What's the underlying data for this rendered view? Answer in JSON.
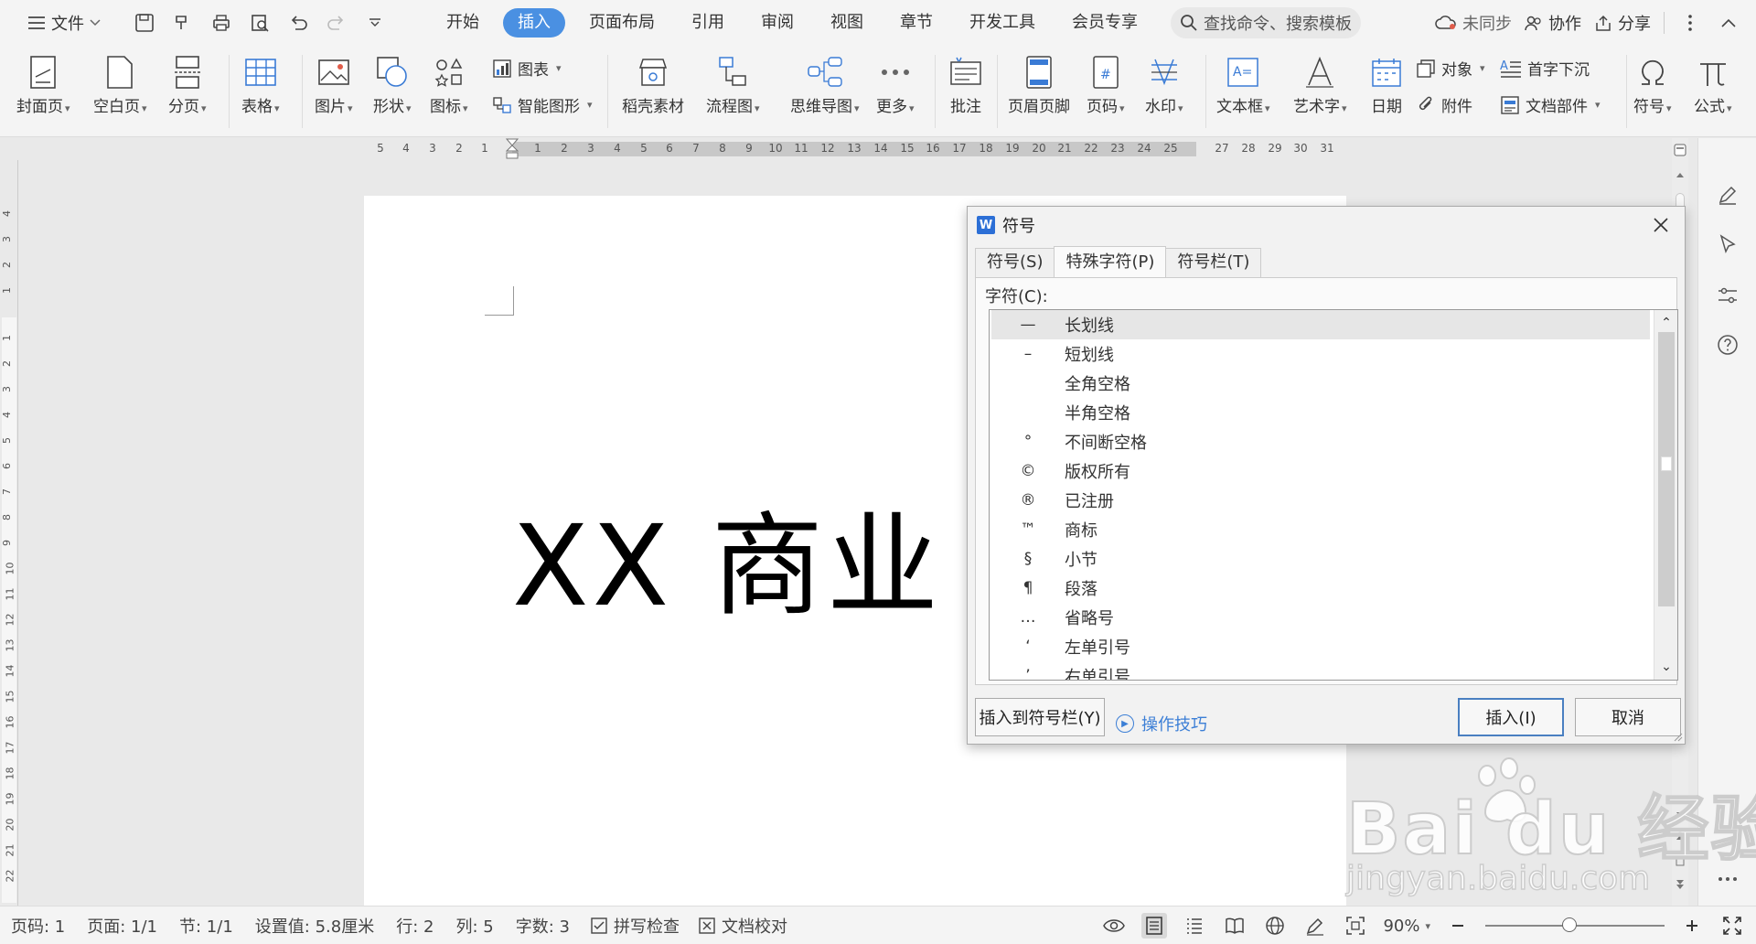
{
  "menubar": {
    "file_label": "文件",
    "tabs": [
      {
        "label": "开始",
        "active": false
      },
      {
        "label": "插入",
        "active": true
      },
      {
        "label": "页面布局",
        "active": false
      },
      {
        "label": "引用",
        "active": false
      },
      {
        "label": "审阅",
        "active": false
      },
      {
        "label": "视图",
        "active": false
      },
      {
        "label": "章节",
        "active": false
      },
      {
        "label": "开发工具",
        "active": false
      },
      {
        "label": "会员专享",
        "active": false
      }
    ],
    "search_placeholder": "查找命令、搜索模板",
    "sync_label": "未同步",
    "collab_label": "协作",
    "share_label": "分享",
    "active_tab_color": "#4a90e2"
  },
  "ribbon": {
    "cover": "封面页",
    "blank": "空白页",
    "pagebreak": "分页",
    "table": "表格",
    "picture": "图片",
    "shape": "形状",
    "icon": "图标",
    "chart": "图表",
    "smartart": "智能图形",
    "material": "稻壳素材",
    "flowchart": "流程图",
    "mindmap": "思维导图",
    "more": "更多",
    "comment": "批注",
    "header_footer": "页眉页脚",
    "page_number": "页码",
    "watermark": "水印",
    "textbox": "文本框",
    "wordart": "艺术字",
    "date": "日期",
    "object": "对象",
    "attachment": "附件",
    "dropcap": "首字下沉",
    "docpart": "文档部件",
    "symbol": "符号",
    "formula": "公式"
  },
  "ruler": {
    "left_numbers": [
      "5",
      "4",
      "3",
      "2",
      "1"
    ],
    "right_numbers": [
      "1",
      "2",
      "3",
      "4",
      "5",
      "6",
      "7",
      "8",
      "9",
      "10",
      "11",
      "12",
      "13",
      "14",
      "15",
      "16",
      "17",
      "18",
      "19",
      "20",
      "21",
      "22",
      "23",
      "24",
      "25"
    ],
    "outer_numbers": [
      "27",
      "28",
      "29",
      "30",
      "31"
    ],
    "vertical_top": [
      "4",
      "3",
      "2",
      "1"
    ],
    "vertical_main": [
      "1",
      "2",
      "3",
      "4",
      "5",
      "6",
      "7",
      "8",
      "9",
      "10",
      "11",
      "12",
      "13",
      "14",
      "15",
      "16",
      "17",
      "18",
      "19",
      "20",
      "21",
      "22"
    ]
  },
  "document": {
    "body_text": "XX 商业"
  },
  "dialog": {
    "title": "符号",
    "tabs": [
      {
        "label": "符号(S)",
        "active": false
      },
      {
        "label": "特殊字符(P)",
        "active": true
      },
      {
        "label": "符号栏(T)",
        "active": false
      }
    ],
    "char_label": "字符(C):",
    "rows": [
      {
        "symbol": "—",
        "name": "长划线",
        "selected": true
      },
      {
        "symbol": "–",
        "name": "短划线",
        "selected": false
      },
      {
        "symbol": "",
        "name": "全角空格",
        "selected": false
      },
      {
        "symbol": "",
        "name": "半角空格",
        "selected": false
      },
      {
        "symbol": "°",
        "name": "不间断空格",
        "selected": false
      },
      {
        "symbol": "©",
        "name": "版权所有",
        "selected": false
      },
      {
        "symbol": "®",
        "name": "已注册",
        "selected": false
      },
      {
        "symbol": "™",
        "name": "商标",
        "selected": false
      },
      {
        "symbol": "§",
        "name": "小节",
        "selected": false
      },
      {
        "symbol": "¶",
        "name": "段落",
        "selected": false
      },
      {
        "symbol": "…",
        "name": "省略号",
        "selected": false
      },
      {
        "symbol": "‘",
        "name": "左单引号",
        "selected": false
      },
      {
        "symbol": "’",
        "name": "右单引号",
        "selected": false
      }
    ],
    "insert_to_bar": "插入到符号栏(Y)",
    "tips": "操作技巧",
    "insert": "插入(I)",
    "cancel": "取消"
  },
  "statusbar": {
    "page_code": "页码: 1",
    "page": "页面: 1/1",
    "section": "节: 1/1",
    "setting": "设置值: 5.8厘米",
    "row": "行: 2",
    "col": "列: 5",
    "wordcount": "字数: 3",
    "spellcheck": "拼写检查",
    "proofread": "文档校对",
    "zoom": "90%",
    "zoom_level_percent": 90
  },
  "watermark": {
    "main": "Bai du 经验",
    "sub": "jingyan.baidu.com"
  }
}
